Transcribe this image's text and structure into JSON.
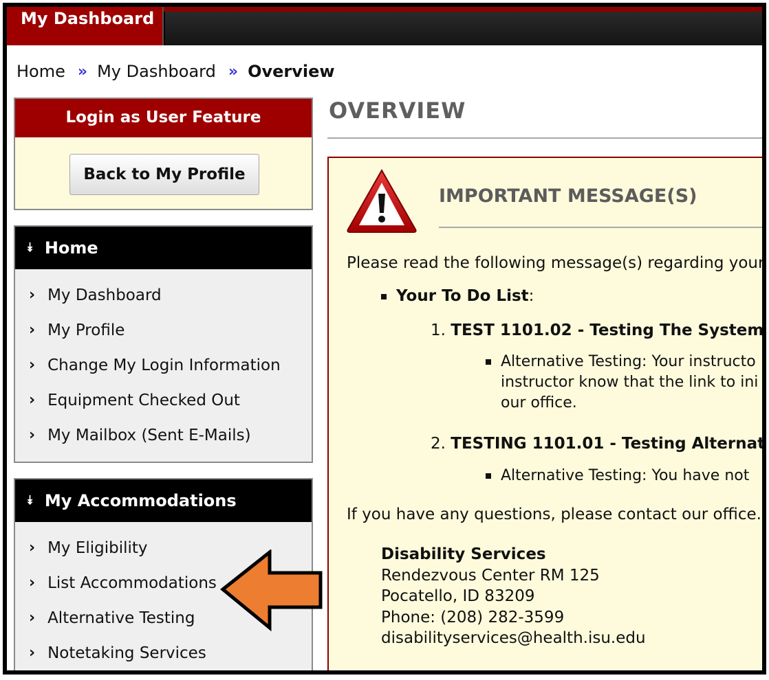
{
  "topbar": {
    "tab_label": "My Dashboard"
  },
  "breadcrumb": {
    "items": [
      "Home",
      "My Dashboard",
      "Overview"
    ],
    "separator": "»"
  },
  "login_feature": {
    "title": "Login as User Feature",
    "back_button": "Back to My Profile"
  },
  "home_panel": {
    "title": "Home",
    "items": [
      "My Dashboard",
      "My Profile",
      "Change My Login Information",
      "Equipment Checked Out",
      "My Mailbox (Sent E-Mails)"
    ]
  },
  "accommodations_panel": {
    "title": "My Accommodations",
    "items": [
      "My Eligibility",
      "List Accommodations",
      "Alternative Testing",
      "Notetaking Services"
    ]
  },
  "main": {
    "title": "OVERVIEW",
    "message": {
      "title": "IMPORTANT MESSAGE(S)",
      "intro": "Please read the following message(s) regarding your a",
      "todo_label": "Your To Do List",
      "todo_suffix": ":",
      "courses": [
        {
          "number": "1.",
          "name": "TEST 1101.02 - Testing The System",
          "detail_lines": [
            "Alternative Testing: Your instructo",
            "instructor know that the link to ini",
            "our office."
          ]
        },
        {
          "number": "2.",
          "name": "TESTING 1101.01 - Testing Alternat",
          "detail_lines": [
            "Alternative Testing: You have not"
          ]
        }
      ],
      "questions": "If you have any questions, please contact our office.",
      "contact": {
        "org": "Disability Services",
        "address1": "Rendezvous Center RM 125",
        "address2": "Pocatello, ID 83209",
        "phone": "Phone: (208) 282-3599",
        "email": "disabilityservices@health.isu.edu"
      }
    }
  },
  "colors": {
    "brand_red": "#9e0000",
    "panel_bg": "#efefef",
    "message_bg": "#fefbdc",
    "breadcrumb_sep": "#3b34d6",
    "annotation_arrow": "#ed7d31"
  },
  "icons": {
    "breadcrumb_separator": "double-chevron-right-icon",
    "panel_header": "double-chevron-down-icon",
    "list_item": "chevron-right-icon",
    "warning": "warning-triangle-icon",
    "annotation": "arrow-left-icon"
  }
}
